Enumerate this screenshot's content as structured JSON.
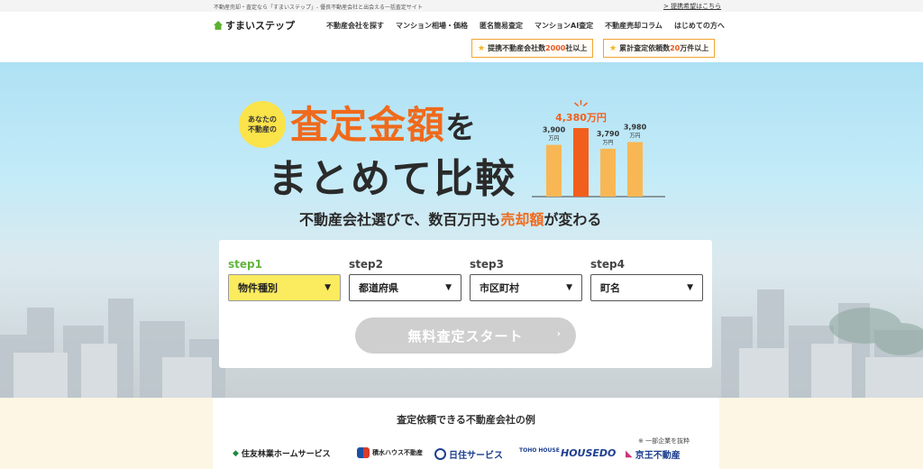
{
  "top_strip": {
    "tagline": "不動産売却・査定なら「すまいステップ」- 優良不動産会社と出会える一括査定サイト",
    "partner_link": "> 提携希望はこちら"
  },
  "header": {
    "logo_text": "すまいステップ",
    "nav": [
      "不動産会社を探す",
      "マンション相場・価格",
      "匿名簡易査定",
      "マンションAI査定",
      "不動産売却コラム",
      "はじめての方へ"
    ],
    "badges": [
      {
        "prefix": "提携不動産会社数",
        "num": "2000",
        "suffix": "社以上"
      },
      {
        "prefix": "累計査定依頼数",
        "num": "20",
        "suffix": "万件以上"
      }
    ]
  },
  "hero": {
    "bubble_line1": "あなたの",
    "bubble_line2": "不動産の",
    "headline_big": "査定金額",
    "headline_wo": "を",
    "headline2": "まとめて比較",
    "sub_pre": "不動産会社選びで、数百万円も",
    "sub_hl": "売却額",
    "sub_post": "が変わる",
    "mini_chart": {
      "values": [
        3900,
        4380,
        3790,
        3980
      ],
      "labels": [
        "3,900",
        "4,380",
        "3,790",
        "3,980"
      ],
      "unit": "万円",
      "highlight_index": 1,
      "colors": {
        "normal": "#f8b754",
        "highlight": "#f25f1c"
      }
    }
  },
  "form": {
    "steps": [
      {
        "label": "step1",
        "value": "物件種別"
      },
      {
        "label": "step2",
        "value": "都道府県"
      },
      {
        "label": "step3",
        "value": "市区町村"
      },
      {
        "label": "step4",
        "value": "町名"
      }
    ],
    "arrow": "▼",
    "start_label": "無料査定スタート",
    "start_chevron": "›"
  },
  "companies": {
    "heading": "査定依頼できる不動産会社の例",
    "note": "※ 一部企業を抜粋",
    "logos": [
      "住友林業ホームサービス",
      "積水ハウス不動産",
      "日住サービス",
      "TOHO HOUSE",
      "HOUSEDO",
      "京王不動産"
    ]
  },
  "colors": {
    "accent": "#ef6a1c",
    "active_step": "#62b53f",
    "select_active": "#fbeb5e"
  }
}
